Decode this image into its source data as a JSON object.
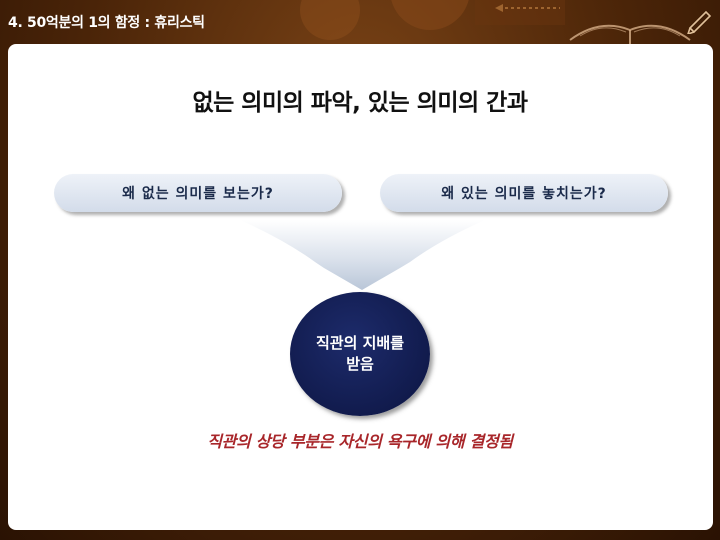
{
  "header": {
    "title": "4. 50억분의 1의 함정 : 휴리스틱"
  },
  "slide": {
    "title": "없는 의미의 파악, 있는 의미의 간과",
    "left_question": "왜 없는 의미를 보는가?",
    "right_question": "왜 있는 의미를 놓치는가?",
    "center_line1": "직관의 지배를",
    "center_line2": "받음",
    "caption": "직관의 상당 부분은 자신의 욕구에 의해 결정됨"
  },
  "colors": {
    "background": "#4a2408",
    "panel": "#ffffff",
    "pill": "#dde4ef",
    "circle": "#111b4d",
    "caption": "#a8262a",
    "funnel": "#c8d3e2"
  }
}
